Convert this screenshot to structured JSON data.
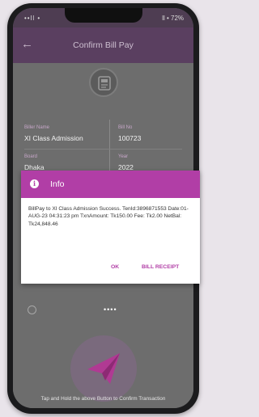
{
  "status_bar": {
    "left": "••ll •",
    "right": "ll • 72%"
  },
  "app_bar": {
    "title": "Confirm Bill Pay",
    "back_icon": "arrow-left-icon"
  },
  "biller": {
    "logo_icon": "bill-document-icon",
    "fields": [
      {
        "label": "Biller Name",
        "value": "XI Class Admission"
      },
      {
        "label": "Bill No",
        "value": "100723"
      },
      {
        "label": "Board",
        "value": "Dhaka"
      },
      {
        "label": "Year",
        "value": "2022"
      }
    ]
  },
  "dialog": {
    "title": "Info",
    "icon": "info-icon",
    "message": "BillPay to XI Class Admission Success. TenId:3896871553 Date:01-AUG-23 04:31:23 pm TxnAmount: Tk150.00 Fee: Tk2.00 NetBal: Tk24,848.46",
    "ok_label": "OK",
    "receipt_label": "BILL RECEIPT",
    "accent_color": "#b13ea6"
  },
  "pin": {
    "icon": "lock-icon",
    "value": "••••"
  },
  "confirm": {
    "icon": "send-icon",
    "hint": "Tap and Hold the above Button to Confirm Transaction"
  }
}
